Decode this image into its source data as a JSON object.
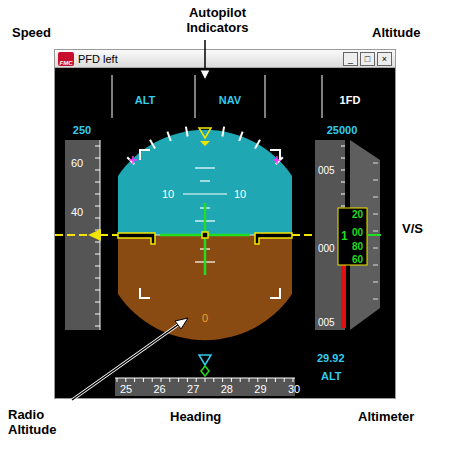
{
  "annotations": {
    "speed": "Speed",
    "autopilot": "Autopilot Indicators",
    "altitude": "Altitude",
    "vs": "V/S",
    "radio": "Radio Altitude",
    "heading": "Heading",
    "altimeter": "Altimeter"
  },
  "window": {
    "title": "PFD left",
    "icon": "FMC",
    "buttons": [
      "_",
      "□",
      "×"
    ]
  },
  "pfd": {
    "modes": [
      {
        "label": "ALT",
        "color": "#33ccee"
      },
      {
        "label": "NAV",
        "color": "#33ccee"
      },
      {
        "label": "1FD",
        "color": "#ffffff"
      }
    ],
    "speed": {
      "selected": "250",
      "ticks": [
        "60",
        "40"
      ]
    },
    "altitude": {
      "selected": "25000",
      "ticks": [
        "005",
        "000",
        "005"
      ],
      "thousands": "1",
      "drum": [
        "20",
        "00",
        "80",
        "60"
      ]
    },
    "pitch": {
      "labels": [
        "10",
        "10"
      ]
    },
    "radio_altitude": "0",
    "heading": {
      "ticks": [
        "25",
        "26",
        "27",
        "28",
        "29",
        "30"
      ]
    },
    "altimeter": {
      "setting": "29.92",
      "mode": "ALT"
    }
  }
}
